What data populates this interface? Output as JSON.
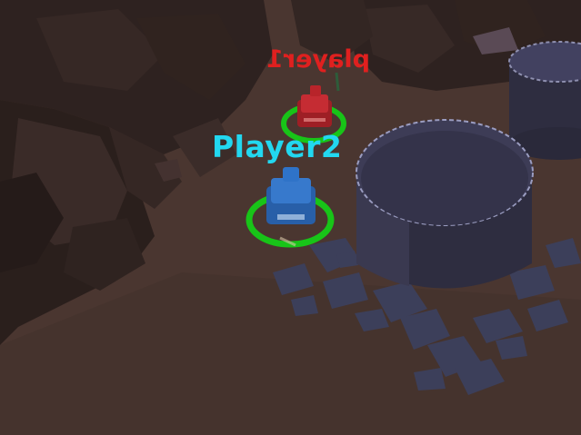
{
  "players": [
    {
      "id": "p1",
      "name": "player1",
      "color": "#e0201f",
      "tank_color": "#b8242a",
      "ring_color": "#18c418"
    },
    {
      "id": "p2",
      "name": "Player2",
      "color": "#22d8f0",
      "tank_color": "#2f73c8",
      "ring_color": "#18c418"
    }
  ],
  "palette": {
    "ground": "#4a3630",
    "rock_dark": "#2b1f1d",
    "rock_mid": "#3a2b28",
    "tank_storage": "#3d3c52",
    "rubble": "#3c3f5a"
  }
}
